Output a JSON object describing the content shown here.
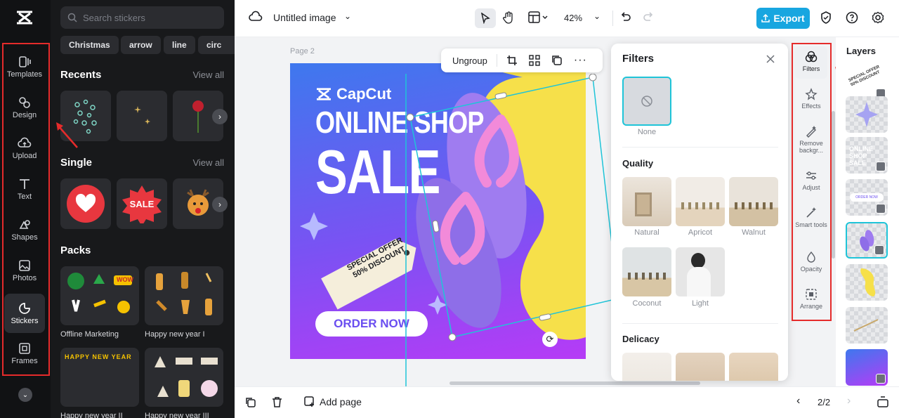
{
  "rail": {
    "items": [
      {
        "label": "Templates"
      },
      {
        "label": "Design"
      },
      {
        "label": "Upload"
      },
      {
        "label": "Text"
      },
      {
        "label": "Shapes"
      },
      {
        "label": "Photos"
      },
      {
        "label": "Stickers"
      },
      {
        "label": "Frames"
      }
    ]
  },
  "stickers": {
    "search_placeholder": "Search stickers",
    "chips": [
      "Christmas",
      "arrow",
      "line",
      "circ"
    ],
    "recents_title": "Recents",
    "single_title": "Single",
    "packs_title": "Packs",
    "view_all": "View all",
    "sale_text": "SALE",
    "packs": [
      {
        "label": "Offline Marketing"
      },
      {
        "label": "Happy new year I"
      },
      {
        "label": "Happy new year II"
      },
      {
        "label": "Happy new year III"
      }
    ],
    "pack_text": "HAPPY NEW YEAR",
    "pack_text_2": "WOW"
  },
  "topbar": {
    "title": "Untitled image",
    "zoom": "42%",
    "export_label": "Export"
  },
  "canvas": {
    "page_label": "Page 2",
    "ungroup_label": "Ungroup",
    "brand": "CapCut",
    "headline_1": "ONLINE SHOP",
    "headline_2": "SALE",
    "tag_line_1": "SPECIAL OFFER",
    "tag_line_2": "50% DISCOUNT",
    "cta": "ORDER NOW"
  },
  "filters": {
    "title": "Filters",
    "none_label": "None",
    "quality_title": "Quality",
    "quality_items": [
      {
        "label": "Natural"
      },
      {
        "label": "Apricot"
      },
      {
        "label": "Walnut"
      },
      {
        "label": "Coconut"
      },
      {
        "label": "Light"
      }
    ],
    "delicacy_title": "Delicacy"
  },
  "tools": [
    {
      "label": "Filters"
    },
    {
      "label": "Effects"
    },
    {
      "label": "Remove backgr..."
    },
    {
      "label": "Adjust"
    },
    {
      "label": "Smart tools"
    },
    {
      "label": "Opacity"
    },
    {
      "label": "Arrange"
    }
  ],
  "layers": {
    "title": "Layers",
    "layer_text_1": "SPECIAL OFFER 50% DISCOUNT",
    "layer_text_2": "ONLINE SHOP SALE",
    "layer_text_3": "ORDER NOW"
  },
  "bottombar": {
    "add_page_label": "Add page",
    "page_indicator": "2/2"
  },
  "colors": {
    "accent": "#18a6e0",
    "annotation": "#e52b2b",
    "selection": "#1fc4d8"
  }
}
